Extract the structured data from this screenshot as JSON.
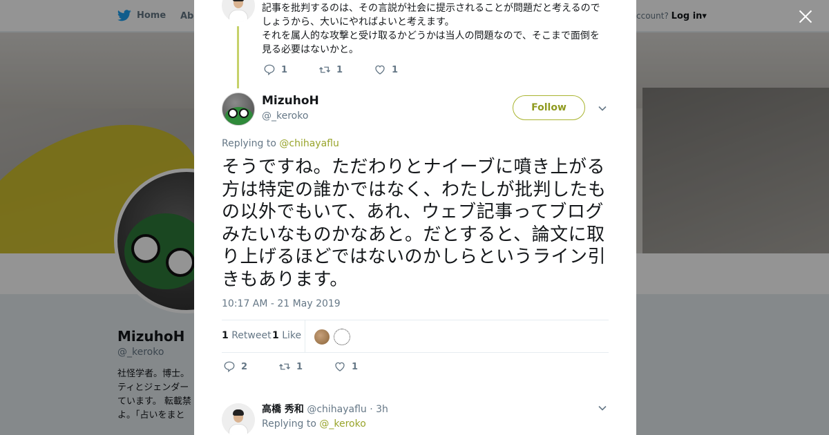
{
  "topbar": {
    "home_label": "Home",
    "about_label": "Abo",
    "account_prompt": "ccount?",
    "login_label": "Log in"
  },
  "profile": {
    "name": "MizuhoH",
    "handle": "@_keroko",
    "bio": "社怪学者。博士。ティとジェンダーています。 転載禁よ。「占いをまと"
  },
  "previous_tweet": {
    "text": "記事を批判するのは、その言説が社会に提示されることが問題だと考えるのでしょうから、大いにやればよいと考えます。\nそれを属人的な攻撃と受け取るかどうかは当人の問題なので、そこまで面倒を見る必要はないかと。",
    "replies": "1",
    "retweets": "1",
    "likes": "1"
  },
  "tweet": {
    "author_name": "MizuhoH",
    "author_handle": "@_keroko",
    "follow_label": "Follow",
    "replying_prefix": "Replying to",
    "replying_to": "@chihayaflu",
    "text": "そうですね。ただわりとナイーブに噴き上がる方は特定の誰かではなく、わたしが批判したもの以外でもいて、あれ、ウェブ記事ってブログみたいなものかなあと。だとすると、論文に取り上げるほどではないのかしらというライン引きもあります。",
    "timestamp": "10:17 AM - 21 May 2019",
    "retweet_count": "1",
    "retweet_label": "Retweet",
    "like_count": "1",
    "like_label": "Like",
    "replies": "2",
    "retweets": "1",
    "likes": "1"
  },
  "next_reply": {
    "author_name": "高橋 秀和",
    "author_handle": "@chihayaflu",
    "time": "· 3h",
    "replying_prefix": "Replying to",
    "replying_to": "@_keroko"
  },
  "colors": {
    "accent": "#98a42a",
    "thread_line": "#c6d16a",
    "secondary_text": "#657786"
  },
  "icons": [
    "twitter-bird-icon",
    "close-icon",
    "reply-icon",
    "retweet-icon",
    "like-icon",
    "chevron-down-icon"
  ]
}
